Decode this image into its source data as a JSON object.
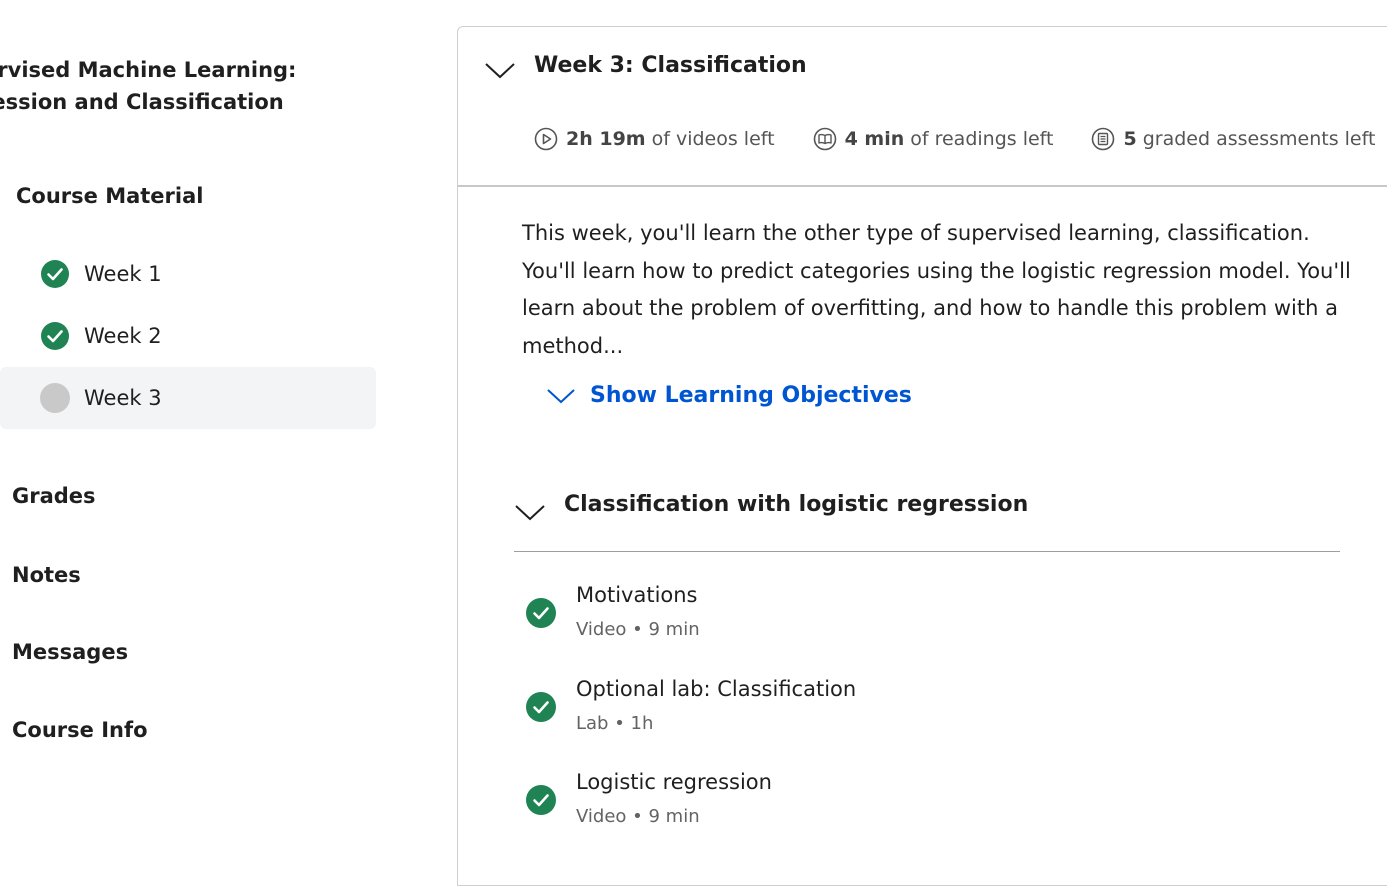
{
  "sidebar": {
    "course_title_line1": "pervised Machine Learning:",
    "course_title_line2": "gression and Classification",
    "section_label": "Course Material",
    "weeks": [
      {
        "label": "Week 1",
        "status": "completed"
      },
      {
        "label": "Week 2",
        "status": "completed"
      },
      {
        "label": "Week 3",
        "status": "in-progress"
      }
    ],
    "nav": [
      {
        "label": "Grades"
      },
      {
        "label": "Notes"
      },
      {
        "label": "Messages"
      },
      {
        "label": "Course Info"
      }
    ]
  },
  "main": {
    "week_title": "Week 3: Classification",
    "stats": {
      "videos_value": "2h 19m",
      "videos_suffix": "of videos left",
      "readings_value": "4 min",
      "readings_suffix": "of readings left",
      "assessments_value": "5",
      "assessments_suffix": "graded assessments left"
    },
    "description": "This week, you'll learn the other type of supervised learning, classification. You'll learn how to predict categories using the logistic regression model. You'll learn about the problem of overfitting, and how to handle this problem with a method...",
    "objectives_link": "Show Learning Objectives",
    "module": {
      "title": "Classification with logistic regression",
      "items": [
        {
          "title": "Motivations",
          "meta": "Video • 9 min"
        },
        {
          "title": "Optional lab: Classification",
          "meta": "Lab • 1h"
        },
        {
          "title": "Logistic regression",
          "meta": "Video • 9 min"
        }
      ]
    }
  },
  "colors": {
    "success_green": "#1f8354",
    "link_blue": "#0056d2",
    "pending_gray": "#c9c9c9"
  }
}
